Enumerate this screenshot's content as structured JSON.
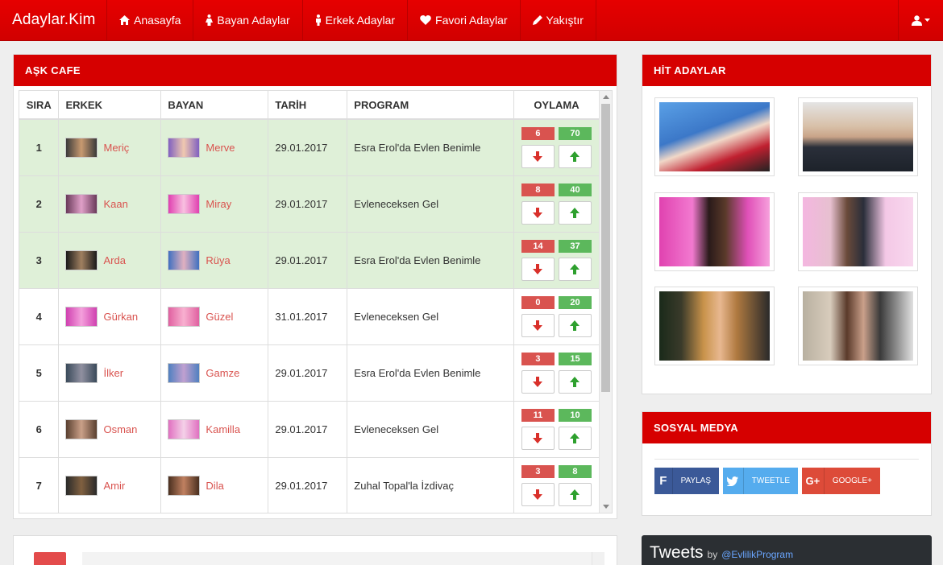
{
  "brand": "Adaylar.Kim",
  "nav": [
    {
      "label": "Anasayfa",
      "icon": "home-icon"
    },
    {
      "label": "Bayan Adaylar",
      "icon": "female-icon"
    },
    {
      "label": "Erkek Adaylar",
      "icon": "male-icon"
    },
    {
      "label": "Favori Adaylar",
      "icon": "heart-icon"
    },
    {
      "label": "Yakıştır",
      "icon": "pencil-icon"
    }
  ],
  "user_menu_icon": "user-icon",
  "ask_cafe": {
    "title": "AŞK CAFE",
    "columns": [
      "SIRA",
      "ERKEK",
      "BAYAN",
      "TARİH",
      "PROGRAM",
      "OYLAMA"
    ],
    "rows": [
      {
        "rank": "1",
        "man": "Meriç",
        "woman": "Merve",
        "date": "29.01.2017",
        "program": "Esra Erol'da Evlen Benimle",
        "down": "6",
        "up": "70",
        "highlight": true
      },
      {
        "rank": "2",
        "man": "Kaan",
        "woman": "Miray",
        "date": "29.01.2017",
        "program": "Evleneceksen Gel",
        "down": "8",
        "up": "40",
        "highlight": true
      },
      {
        "rank": "3",
        "man": "Arda",
        "woman": "Rüya",
        "date": "29.01.2017",
        "program": "Esra Erol'da Evlen Benimle",
        "down": "14",
        "up": "37",
        "highlight": true
      },
      {
        "rank": "4",
        "man": "Gürkan",
        "woman": "Güzel",
        "date": "31.01.2017",
        "program": "Evleneceksen Gel",
        "down": "0",
        "up": "20",
        "highlight": false
      },
      {
        "rank": "5",
        "man": "İlker",
        "woman": "Gamze",
        "date": "29.01.2017",
        "program": "Esra Erol'da Evlen Benimle",
        "down": "3",
        "up": "15",
        "highlight": false
      },
      {
        "rank": "6",
        "man": "Osman",
        "woman": "Kamilla",
        "date": "29.01.2017",
        "program": "Evleneceksen Gel",
        "down": "11",
        "up": "10",
        "highlight": false
      },
      {
        "rank": "7",
        "man": "Amir",
        "woman": "Dila",
        "date": "29.01.2017",
        "program": "Zuhal Topal'la İzdivaç",
        "down": "3",
        "up": "8",
        "highlight": false
      }
    ]
  },
  "hit_adaylar": {
    "title": "HİT ADAYLAR"
  },
  "sosyal_medya": {
    "title": "SOSYAL MEDYA",
    "buttons": [
      {
        "label": "PAYLAŞ",
        "icon": "facebook-icon",
        "color": "#3b5998"
      },
      {
        "label": "TWEETLE",
        "icon": "twitter-icon",
        "color": "#55acee"
      },
      {
        "label": "GOOGLE+",
        "icon": "google-plus-icon",
        "color": "#dd4b39"
      }
    ]
  },
  "tweets": {
    "title": "Tweets",
    "by": "by",
    "handle": "@EvlilikProgram"
  },
  "colors": {
    "accent": "#d60000",
    "highlight_row": "#dff0d8",
    "vote_down": "#d9534f",
    "vote_up": "#5cb85c"
  }
}
